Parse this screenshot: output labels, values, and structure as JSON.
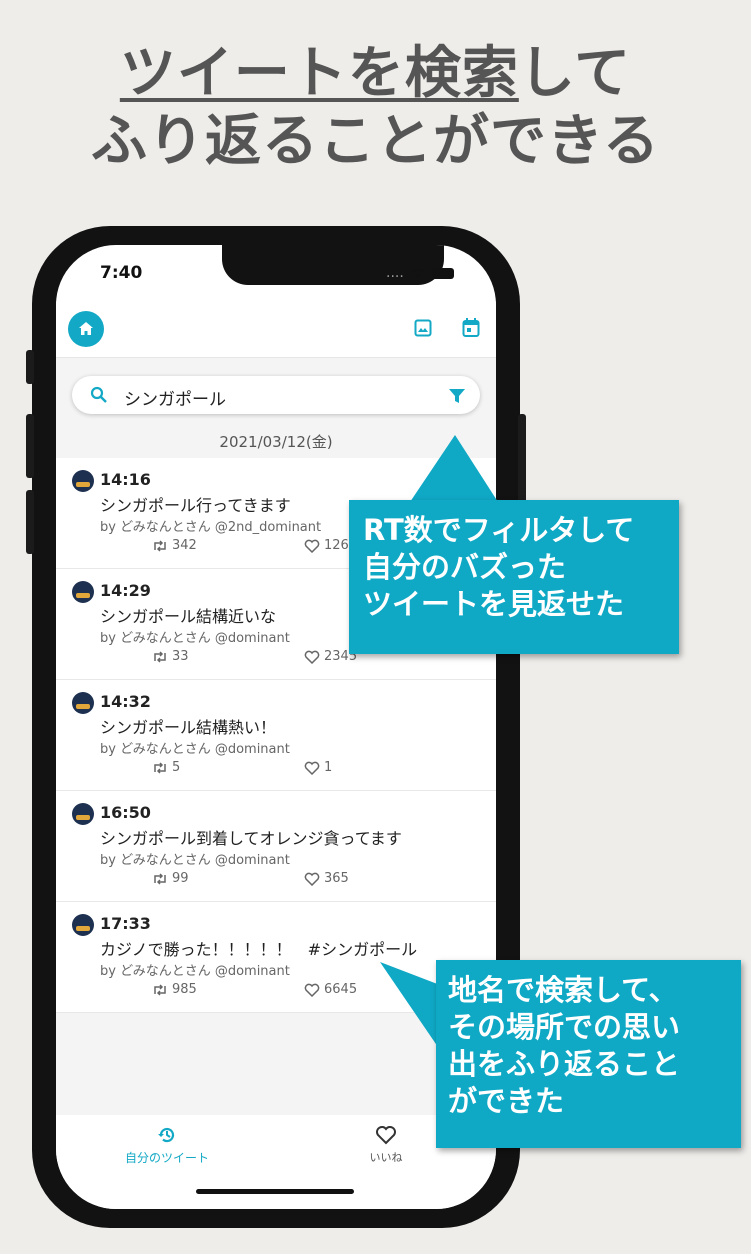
{
  "headline": {
    "line1_underlined": "ツイートを検索",
    "line1_rest": "して",
    "line2": "ふり返ることができる"
  },
  "status_bar": {
    "time": "7:40",
    "signal": "....",
    "wifi_icon": "wifi-icon",
    "battery_icon": "battery-icon"
  },
  "search": {
    "value": "シンガポール",
    "icon": "search-icon",
    "filter_icon": "filter-icon"
  },
  "date_header": "2021/03/12(金)",
  "tweets": [
    {
      "time": "14:16",
      "text": "シンガポール行ってきます",
      "by": "by どみなんとさん @2nd_dominant",
      "rt": "342",
      "likes": "126"
    },
    {
      "time": "14:29",
      "text": "シンガポール結構近いな",
      "by": "by どみなんとさん @dominant",
      "rt": "33",
      "likes": "2345"
    },
    {
      "time": "14:32",
      "text": "シンガポール結構熱い！",
      "by": "by どみなんとさん @dominant",
      "rt": "5",
      "likes": "1"
    },
    {
      "time": "16:50",
      "text": "シンガポール到着してオレンジ貪ってます",
      "by": "by どみなんとさん @dominant",
      "rt": "99",
      "likes": "365"
    },
    {
      "time": "17:33",
      "text": "カジノで勝った！！！！！　#シンガポール",
      "by": "by どみなんとさん @dominant",
      "rt": "985",
      "likes": "6645"
    }
  ],
  "bottom_nav": {
    "my_tweets": "自分のツイート",
    "likes": "いいね"
  },
  "callout_filter": {
    "l1": "RT数でフィルタして",
    "l2": "自分のバズった",
    "l3": "ツイートを見返せた"
  },
  "callout_search": {
    "l1": "地名で検索して、",
    "l2": "その場所での思い",
    "l3": "出をふり返ること",
    "l4": "ができた"
  },
  "colors": {
    "accent": "#13a9c6",
    "callout": "#0fa8c5",
    "background": "#efedea"
  }
}
